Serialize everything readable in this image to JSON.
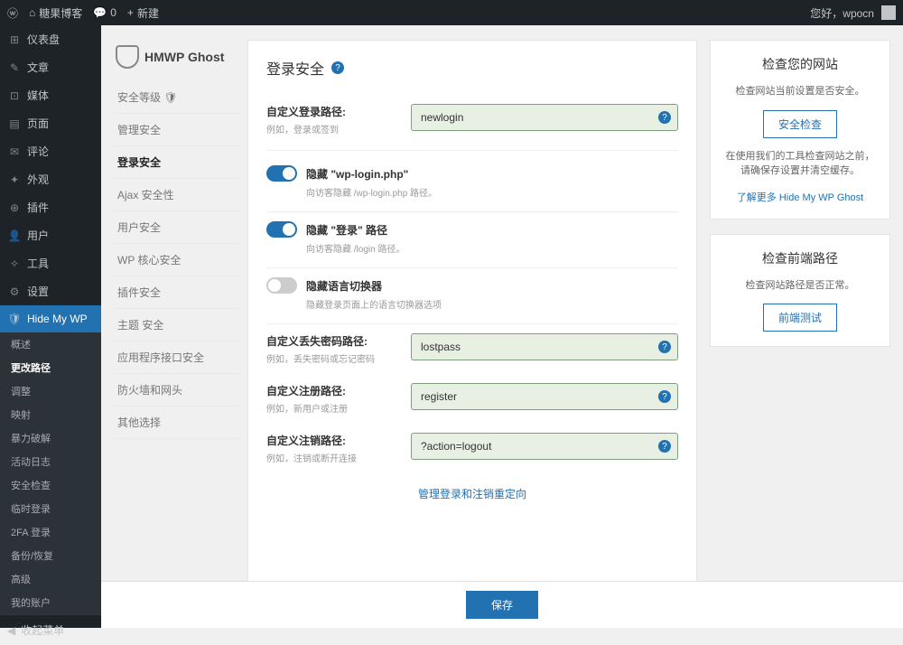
{
  "topbar": {
    "site_name": "糖果博客",
    "comments_count": "0",
    "new_label": "新建",
    "greeting": "您好，wpocn"
  },
  "wp_menu": [
    {
      "icon": "⊞",
      "label": "仪表盘"
    },
    {
      "icon": "✎",
      "label": "文章"
    },
    {
      "icon": "⊡",
      "label": "媒体"
    },
    {
      "icon": "▤",
      "label": "页面"
    },
    {
      "icon": "✉",
      "label": "评论"
    },
    {
      "icon": "✦",
      "label": "外观"
    },
    {
      "icon": "⊕",
      "label": "插件"
    },
    {
      "icon": "👤",
      "label": "用户"
    },
    {
      "icon": "✧",
      "label": "工具"
    },
    {
      "icon": "⚙",
      "label": "设置"
    },
    {
      "icon": "🛡",
      "label": "Hide My WP",
      "active": true
    }
  ],
  "wp_submenu": [
    "概述",
    "更改路径",
    "调整",
    "映射",
    "暴力破解",
    "活动日志",
    "安全检查",
    "临时登录",
    "2FA 登录",
    "备份/恢复",
    "高级",
    "我的账户"
  ],
  "wp_submenu_active": "更改路径",
  "collapse_label": "收起菜单",
  "plugin": {
    "brand": "HMWP Ghost",
    "nav": [
      "安全等级 🛡",
      "管理安全",
      "登录安全",
      "Ajax 安全性",
      "用户安全",
      "WP 核心安全",
      "插件安全",
      "主题 安全",
      "应用程序接口安全",
      "防火墙和网头",
      "其他选择"
    ],
    "nav_active": "登录安全"
  },
  "panel": {
    "title": "登录安全",
    "fields": {
      "login": {
        "label": "自定义登录路径:",
        "hint": "例如，登录或签到",
        "value": "newlogin"
      },
      "lostpass": {
        "label": "自定义丢失密码路径:",
        "hint": "例如，丢失密码或忘记密码",
        "value": "lostpass"
      },
      "register": {
        "label": "自定义注册路径:",
        "hint": "例如，新用户或注册",
        "value": "register"
      },
      "logout": {
        "label": "自定义注销路径:",
        "hint": "例如，注销或断开连接",
        "value": "?action=logout"
      }
    },
    "toggles": {
      "hide_wplogin": {
        "label": "隐藏 \"wp-login.php\"",
        "hint": "向访客隐藏 /wp-login.php 路径。",
        "on": true
      },
      "hide_login": {
        "label": "隐藏 \"登录\" 路径",
        "hint": "向访客隐藏 /login 路径。",
        "on": true
      },
      "hide_lang": {
        "label": "隐藏语言切换器",
        "hint": "隐藏登录页面上的语言切换器选项",
        "on": false
      }
    },
    "manage_link": "管理登录和注销重定向"
  },
  "right": {
    "check_site": {
      "title": "检查您的网站",
      "text1": "检查网站当前设置是否安全。",
      "btn": "安全检查",
      "text2": "在使用我们的工具检查网站之前，请确保存设置并清空缓存。",
      "link": "了解更多 Hide My WP Ghost"
    },
    "check_front": {
      "title": "检查前端路径",
      "text": "检查网站路径是否正常。",
      "btn": "前端测试"
    }
  },
  "save_label": "保存"
}
